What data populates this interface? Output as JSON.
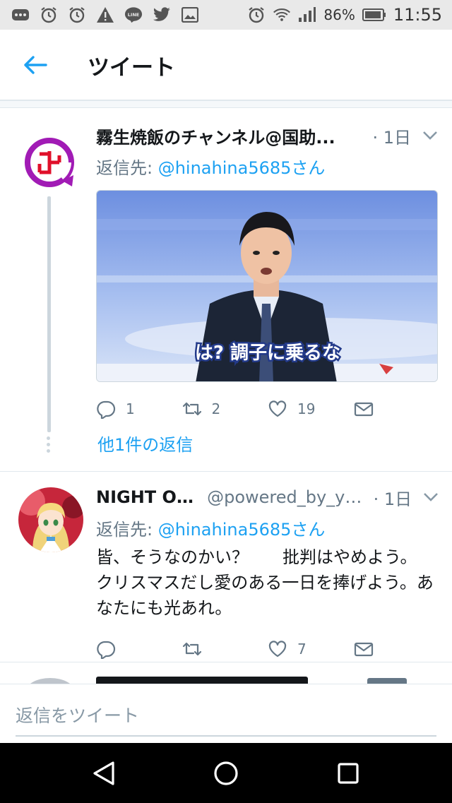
{
  "status_bar": {
    "battery_percent": "86%",
    "time": "11:55",
    "icons": [
      "more-icon",
      "alarm-icon",
      "alarm-icon",
      "warning-icon",
      "line-icon",
      "twitter-icon",
      "image-icon",
      "alarm-icon",
      "wifi-icon",
      "signal-icon",
      "battery-icon"
    ]
  },
  "header": {
    "title": "ツイート"
  },
  "tweets": [
    {
      "display_name": "霧生焼飯のチャンネル@国助...",
      "handle": "",
      "time": "· 1日",
      "reply_prefix": "返信先: ",
      "reply_to": "@hinahina5685さん",
      "text": "",
      "media_caption": "は? 調子に乗るな",
      "replies": "1",
      "retweets": "2",
      "likes": "19",
      "more_replies": "他1件の返信"
    },
    {
      "display_name": "NIGHT OWL",
      "handle": "@powered_by_yu...",
      "time": "· 1日",
      "reply_prefix": "返信先: ",
      "reply_to": "@hinahina5685さん",
      "text": "皆、そうなのかい？　　批判はやめよう。　クリスマスだし愛のある一日を捧げよう。あなたにも光あれ。",
      "replies": "",
      "retweets": "",
      "likes": "7"
    }
  ],
  "composer": {
    "placeholder": "返信をツイート"
  },
  "colors": {
    "accent": "#1da1f2",
    "secondary_text": "#657786",
    "primary_text": "#14171a",
    "avatar1_ring": "#a11bb5"
  }
}
